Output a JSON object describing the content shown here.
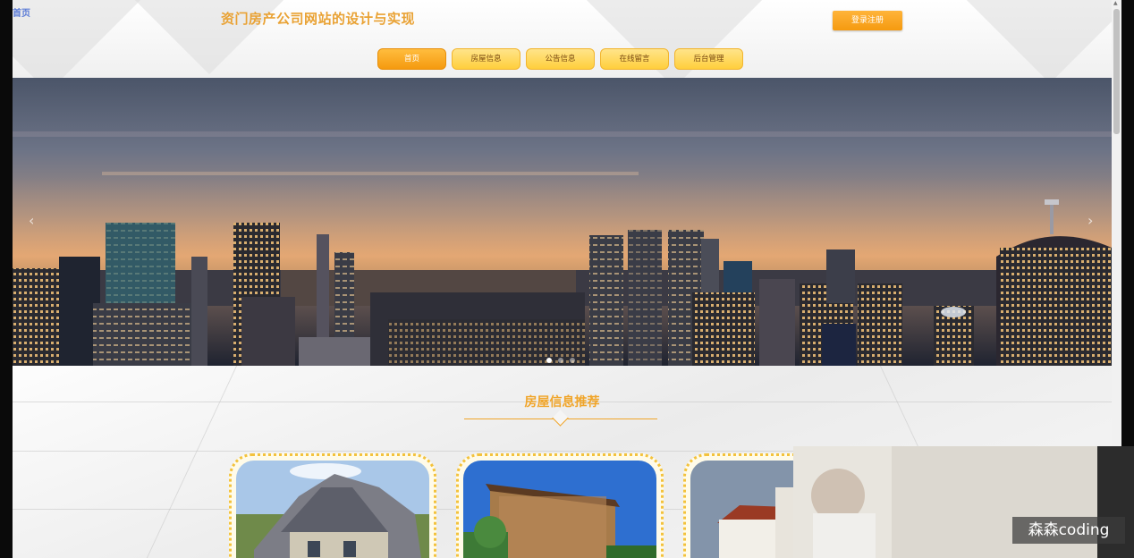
{
  "corner_tag": "首页",
  "header": {
    "site_title": "资门房产公司网站的设计与实现",
    "login_label": "登录注册"
  },
  "nav": {
    "items": [
      "首页",
      "房屋信息",
      "公告信息",
      "在线留言",
      "后台管理"
    ],
    "active_index": 0
  },
  "banner": {
    "prev_glyph": "‹",
    "next_glyph": "›",
    "slides_total": 3,
    "slide_active": 1
  },
  "section": {
    "title": "房屋信息推荐"
  },
  "overlay": {
    "watermark": "森森coding"
  },
  "colors": {
    "accent": "#f0a52a",
    "button": "#f59a0f",
    "nav_bg": "#ffcf3c"
  }
}
